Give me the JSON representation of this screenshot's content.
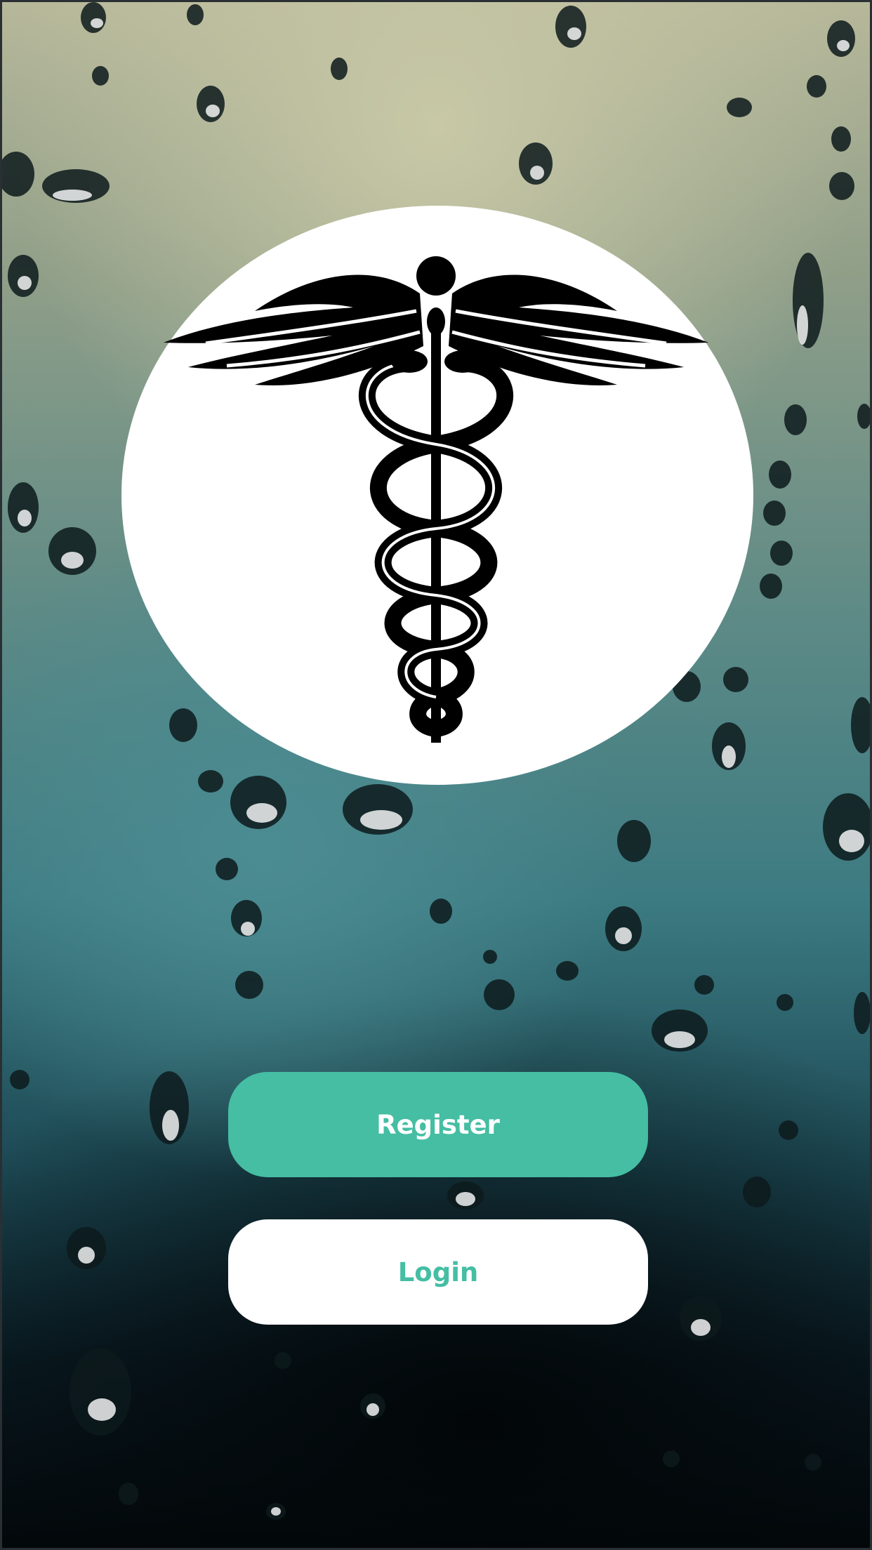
{
  "background": {
    "image": "rain-drops-on-glass",
    "colors": {
      "top": "#b7b89a",
      "middle": "#3c7b82",
      "bottom": "#03080b"
    }
  },
  "logo": {
    "icon": "caduceus-icon",
    "color": "#000000",
    "background": "#ffffff"
  },
  "buttons": {
    "register_label": "Register",
    "login_label": "Login"
  },
  "colors": {
    "accent": "#45bea3",
    "white": "#ffffff"
  }
}
